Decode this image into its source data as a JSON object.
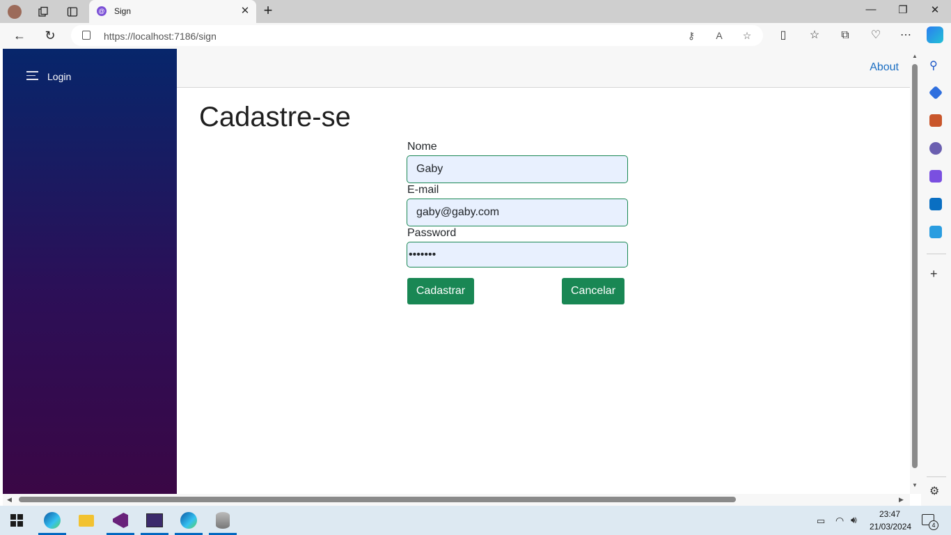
{
  "browser": {
    "tab_title": "Sign",
    "url": "https://localhost:7186/sign"
  },
  "nav": {
    "login_label": "Login",
    "about_label": "About"
  },
  "page": {
    "title": "Cadastre-se"
  },
  "form": {
    "name_label": "Nome",
    "name_value": "Gaby",
    "email_label": "E-mail",
    "email_value": "gaby@gaby.com",
    "password_label": "Password",
    "password_value": "•••••••",
    "submit_label": "Cadastrar",
    "cancel_label": "Cancelar"
  },
  "taskbar": {
    "time": "23:47",
    "date": "21/03/2024",
    "notification_count": "4"
  },
  "colors": {
    "sidebar_top": "#07266b",
    "sidebar_bottom": "#3a0745",
    "button_green": "#198754",
    "link_blue": "#1b6ec2"
  }
}
